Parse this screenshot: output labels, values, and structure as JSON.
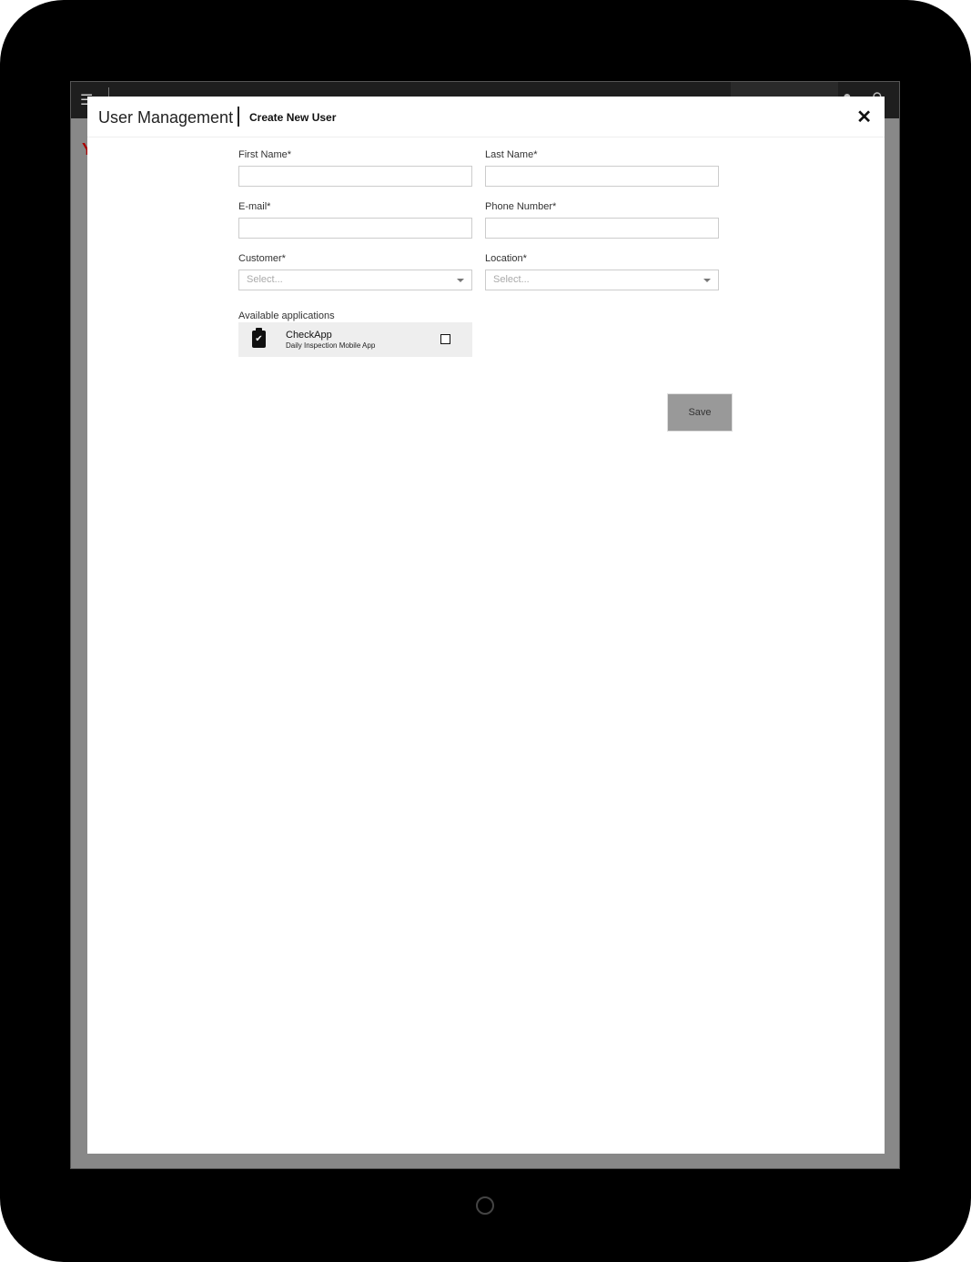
{
  "modal": {
    "title": "User Management",
    "subtitle": "Create New User",
    "close_icon": "close-icon",
    "fields": {
      "first_name": {
        "label": "First Name*",
        "value": ""
      },
      "last_name": {
        "label": "Last Name*",
        "value": ""
      },
      "email": {
        "label": "E-mail*",
        "value": ""
      },
      "phone": {
        "label": "Phone Number*",
        "value": ""
      },
      "customer": {
        "label": "Customer*",
        "placeholder": "Select..."
      },
      "location": {
        "label": "Location*",
        "placeholder": "Select..."
      }
    },
    "applications": {
      "label": "Available applications",
      "items": [
        {
          "name": "CheckApp",
          "description": "Daily Inspection Mobile App",
          "checked": false,
          "icon": "clipboard-check-icon"
        }
      ]
    },
    "save_label": "Save"
  }
}
